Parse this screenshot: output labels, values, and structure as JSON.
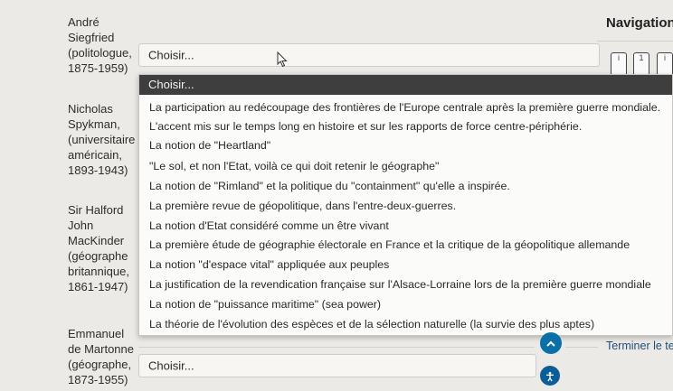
{
  "persons": [
    {
      "lines": [
        "André",
        "Siegfried",
        "(politologue,",
        "1875-1959)"
      ]
    },
    {
      "lines": [
        "Nicholas",
        "Spykman,",
        "(universitaire",
        "américain,",
        "1893-1943)"
      ]
    },
    {
      "lines": [
        "Sir Halford",
        "John",
        "MacKinder",
        "(géographe",
        "britannique,",
        "1861-1947)"
      ]
    },
    {
      "lines": [
        "Emmanuel",
        "de Martonne",
        "(géographe,",
        "1873-1955)"
      ]
    }
  ],
  "select1": {
    "value": "Choisir..."
  },
  "select2": {
    "value": "Choisir..."
  },
  "navigation": {
    "title": "Navigation",
    "boxes": [
      "i",
      "1",
      "i"
    ]
  },
  "dropdown": {
    "header": "Choisir...",
    "options": [
      "La participation au redécoupage des frontières de l'Europe centrale après la première guerre mondiale.",
      "L'accent mis sur le temps long en histoire et sur les rapports de force centre-périphérie.",
      "La notion de \"Heartland\"",
      "\"Le sol, et non l'Etat, voilà ce qui doit retenir le géographe\"",
      "La notion de \"Rimland\" et la politique du \"containment\" qu'elle a inspirée.",
      "La première revue de géopolitique, dans l'entre-deux-guerres.",
      "La notion d'Etat considéré comme un être vivant",
      "La première étude de géographie électorale en France et la critique de la géopolitique allemande",
      "La notion \"d'espace vital\" appliquée aux peuples",
      "La justification de la revendication française sur l'Alsace-Lorraine lors de la première guerre mondiale",
      "La notion de \"puissance maritime\" (sea power)",
      "La théorie de l'évolution des espèces et de la sélection naturelle (la survie des plus aptes)"
    ]
  },
  "footer": {
    "finish_label": "Terminer le tes",
    "scroll_up_icon": "chevron-up-icon",
    "accessibility_icon": "accessibility-icon"
  },
  "colors": {
    "dropdown_header_bg": "#3e3e3e",
    "accent": "#0b6fa8"
  }
}
